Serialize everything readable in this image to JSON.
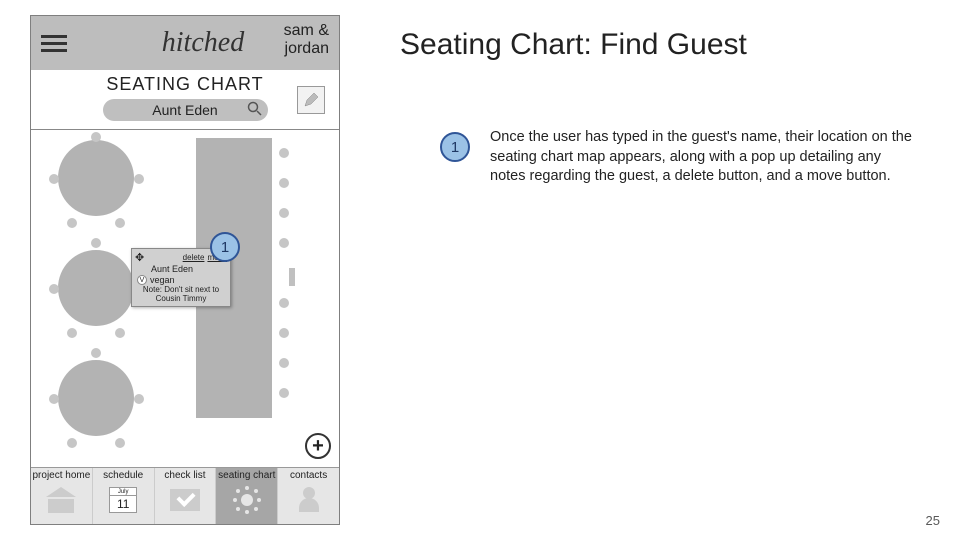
{
  "slide": {
    "title": "Seating Chart: Find Guest",
    "page_number": "25"
  },
  "annotation": {
    "num": "1",
    "text": "Once the user has typed in the guest's name, their location on the seating chart map appears, along with a pop up detailing any notes regarding the guest, a delete button, and a move button."
  },
  "header": {
    "brand": "hitched",
    "couple_line1": "sam &",
    "couple_line2": "jordan"
  },
  "subheader": {
    "screen_title": "SEATING CHART",
    "search_value": "Aunt Eden"
  },
  "popup": {
    "delete": "delete",
    "move": "move",
    "guest_name": "Aunt Eden",
    "diet_code": "V",
    "diet_label": "vegan",
    "note": "Note: Don't sit next to Cousin Timmy"
  },
  "calendar": {
    "month": "July",
    "day": "11"
  },
  "nav": {
    "items": [
      {
        "label": "project home"
      },
      {
        "label": "schedule"
      },
      {
        "label": "check list"
      },
      {
        "label": "seating chart"
      },
      {
        "label": "contacts"
      }
    ]
  }
}
